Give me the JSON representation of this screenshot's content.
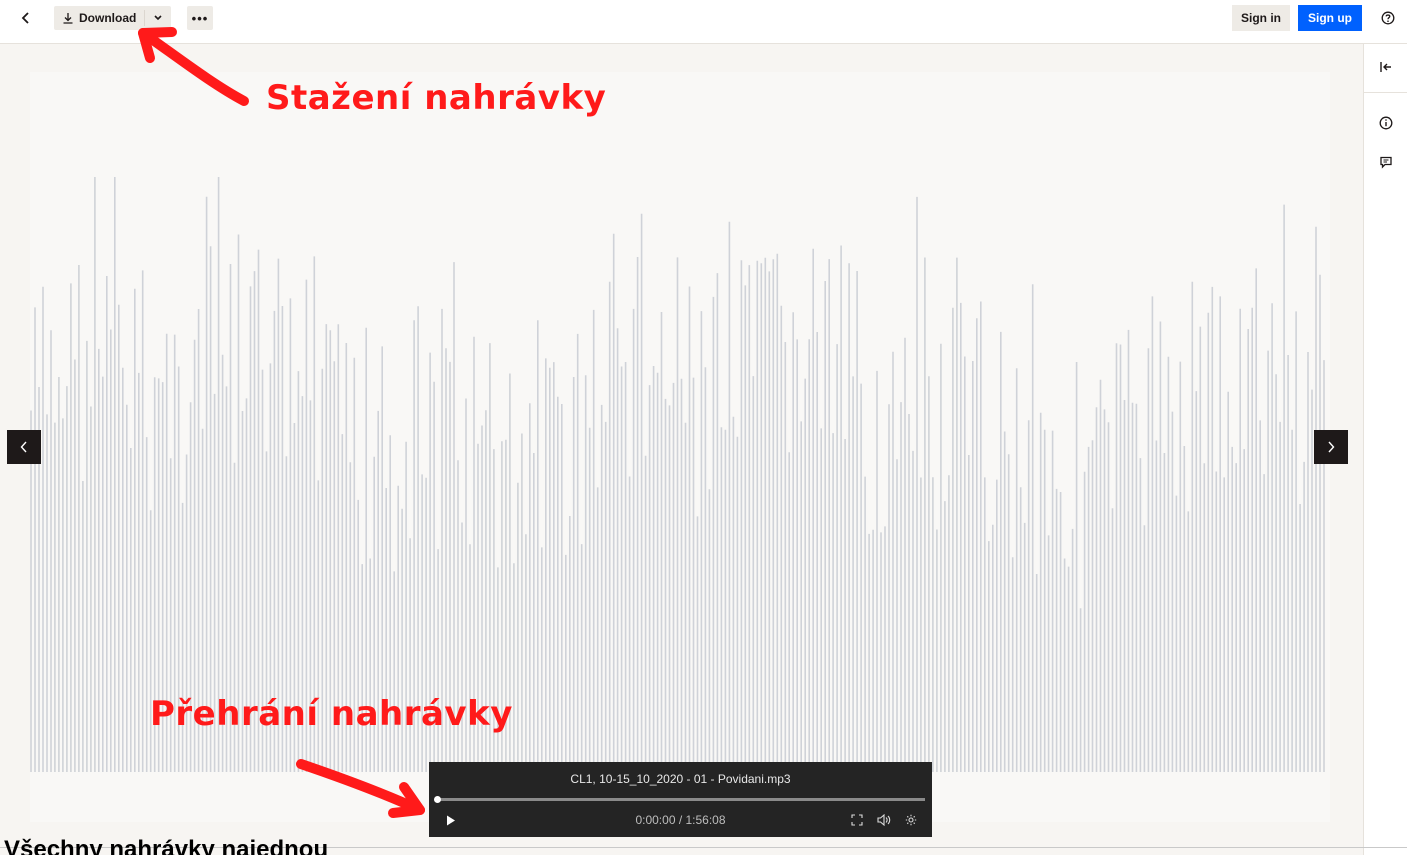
{
  "toolbar": {
    "back_icon": "chevron-left-icon",
    "download_label": "Download",
    "download_icon": "download-icon",
    "download_caret_icon": "chevron-down-icon",
    "more_label": "•••",
    "sign_in_label": "Sign in",
    "sign_up_label": "Sign up",
    "help_icon": "help-icon",
    "sign_up_color": "#0061fe"
  },
  "right_rail": {
    "collapse_icon": "collapse-panel-icon",
    "info_icon": "info-icon",
    "comment_icon": "comment-icon"
  },
  "viewer": {
    "prev_icon": "chevron-left-icon",
    "next_icon": "chevron-right-icon",
    "waveform_color": "#cfd2d8"
  },
  "annotations": {
    "download": "Stažení nahrávky",
    "playback": "Přehrání nahrávky",
    "color": "#ff1a1a"
  },
  "player": {
    "file_name": "CL1, 10-15_10_2020 - 01 - Povidani.mp3",
    "time": "0:00:00 / 1:56:08",
    "progress": 0,
    "play_icon": "play-icon",
    "fullscreen_icon": "fullscreen-icon",
    "volume_icon": "volume-icon",
    "settings_icon": "settings-icon"
  },
  "caption": "Všechny nahrávky najednou"
}
